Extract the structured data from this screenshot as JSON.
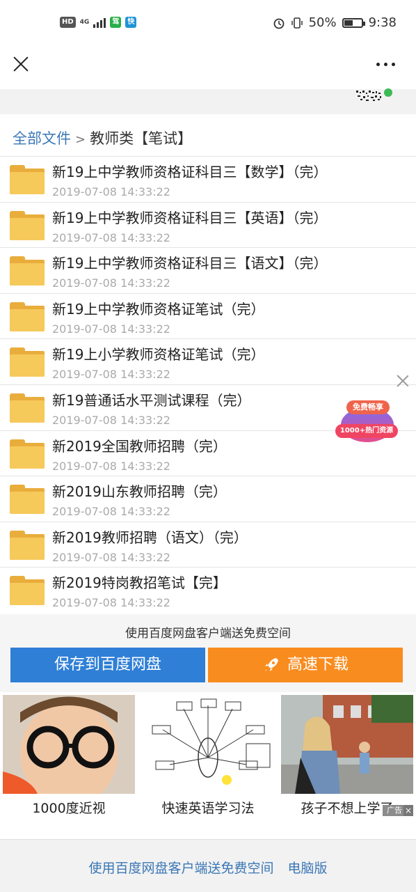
{
  "status_bar": {
    "hd": "HD",
    "network": "4G",
    "app_badge_1": "驾",
    "app_badge_2": "快",
    "battery": "50%",
    "battery_level": 0.5,
    "time": "9:38"
  },
  "breadcrumb": {
    "root": "全部文件",
    "separator": ">",
    "current": "教师类【笔试】"
  },
  "files": [
    {
      "name": "新19上中学教师资格证科目三【数学】（完）",
      "date": "2019-07-08 14:33:22"
    },
    {
      "name": "新19上中学教师资格证科目三【英语】（完）",
      "date": "2019-07-08 14:33:22"
    },
    {
      "name": "新19上中学教师资格证科目三【语文】（完）",
      "date": "2019-07-08 14:33:22"
    },
    {
      "name": "新19上中学教师资格证笔试（完）",
      "date": "2019-07-08 14:33:22"
    },
    {
      "name": "新19上小学教师资格证笔试（完）",
      "date": "2019-07-08 14:33:22"
    },
    {
      "name": "新19普通话水平测试课程（完）",
      "date": "2019-07-08 14:33:22"
    },
    {
      "name": "新2019全国教师招聘（完）",
      "date": "2019-07-08 14:33:22"
    },
    {
      "name": "新2019山东教师招聘（完）",
      "date": "2019-07-08 14:33:22"
    },
    {
      "name": "新2019教师招聘（语文）（完）",
      "date": "2019-07-08 14:33:22"
    },
    {
      "name": "新2019特岗教招笔试【完】",
      "date": "2019-07-08 14:33:22"
    }
  ],
  "float_ad": {
    "top": "免费畅享",
    "bottom": "1000+热门资源"
  },
  "promo": {
    "text": "使用百度网盘客户端送免费空间",
    "save_button": "保存到百度网盘",
    "download_button": "高速下载"
  },
  "ads": [
    {
      "caption": "1000度近视"
    },
    {
      "caption": "快速英语学习法"
    },
    {
      "caption": "孩子不想上学了"
    }
  ],
  "ad_tag": "广告",
  "footer": {
    "link1": "使用百度网盘客户端送免费空间",
    "link2": "电脑版"
  },
  "colors": {
    "link": "#3b77b6",
    "save": "#2f7fd6",
    "download": "#f98c1f",
    "folder": "#f6c95b"
  }
}
